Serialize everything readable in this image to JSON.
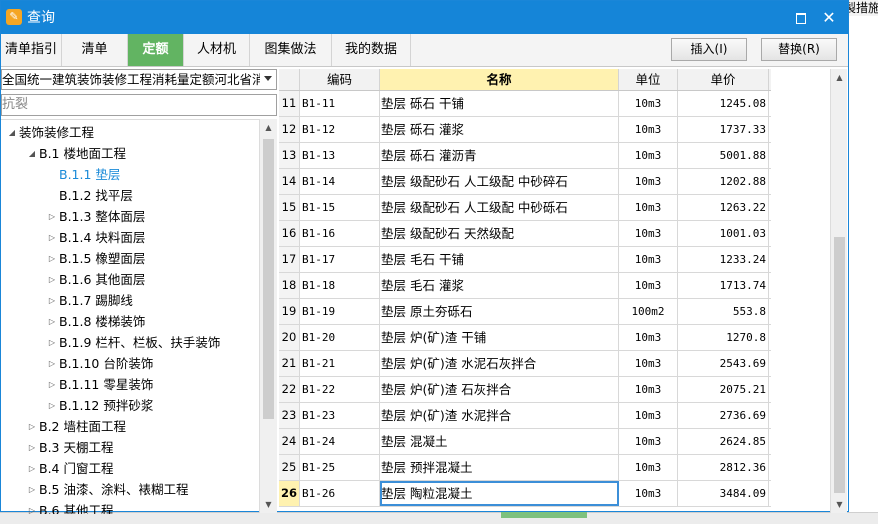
{
  "background_fragment": "製措施",
  "dialog": {
    "title": "查询",
    "restore_icon": "restore-icon",
    "close_glyph": "✕"
  },
  "tabs": [
    {
      "label": "清单指引",
      "active": false
    },
    {
      "label": "清单",
      "active": false
    },
    {
      "label": "定额",
      "active": true
    },
    {
      "label": "人材机",
      "active": false
    },
    {
      "label": "图集做法",
      "active": false
    },
    {
      "label": "我的数据",
      "active": false
    }
  ],
  "buttons": {
    "insert": "插入(I)",
    "replace": "替换(R)"
  },
  "library_select": {
    "value": "全国统一建筑装饰装修工程消耗量定额河北省消耗"
  },
  "search": {
    "value": "抗裂"
  },
  "tree": [
    {
      "label": "装饰装修工程",
      "level": 0,
      "arrow": "expanded"
    },
    {
      "label": "B.1 楼地面工程",
      "level": 1,
      "arrow": "expanded"
    },
    {
      "label": "B.1.1 垫层",
      "level": 2,
      "arrow": "none",
      "selected": true
    },
    {
      "label": "B.1.2 找平层",
      "level": 2,
      "arrow": "none"
    },
    {
      "label": "B.1.3 整体面层",
      "level": 2,
      "arrow": "collapsed"
    },
    {
      "label": "B.1.4 块料面层",
      "level": 2,
      "arrow": "collapsed"
    },
    {
      "label": "B.1.5 橡塑面层",
      "level": 2,
      "arrow": "collapsed"
    },
    {
      "label": "B.1.6 其他面层",
      "level": 2,
      "arrow": "collapsed"
    },
    {
      "label": "B.1.7 踢脚线",
      "level": 2,
      "arrow": "collapsed"
    },
    {
      "label": "B.1.8 楼梯装饰",
      "level": 2,
      "arrow": "collapsed"
    },
    {
      "label": "B.1.9 栏杆、栏板、扶手装饰",
      "level": 2,
      "arrow": "collapsed"
    },
    {
      "label": "B.1.10 台阶装饰",
      "level": 2,
      "arrow": "collapsed"
    },
    {
      "label": "B.1.11 零星装饰",
      "level": 2,
      "arrow": "collapsed"
    },
    {
      "label": "B.1.12 预拌砂浆",
      "level": 2,
      "arrow": "collapsed"
    },
    {
      "label": "B.2 墙柱面工程",
      "level": 1,
      "arrow": "collapsed"
    },
    {
      "label": "B.3 天棚工程",
      "level": 1,
      "arrow": "collapsed"
    },
    {
      "label": "B.4 门窗工程",
      "level": 1,
      "arrow": "collapsed"
    },
    {
      "label": "B.5 油漆、涂料、裱糊工程",
      "level": 1,
      "arrow": "collapsed"
    },
    {
      "label": "B.6 其他工程",
      "level": 1,
      "arrow": "collapsed"
    }
  ],
  "table": {
    "columns": {
      "code": "编码",
      "name": "名称",
      "unit": "单位",
      "price": "单价"
    },
    "rows": [
      {
        "idx": "11",
        "code": "B1-11",
        "name": "垫层 砾石 干铺",
        "unit": "10m3",
        "price": "1245.08"
      },
      {
        "idx": "12",
        "code": "B1-12",
        "name": "垫层 砾石 灌浆",
        "unit": "10m3",
        "price": "1737.33"
      },
      {
        "idx": "13",
        "code": "B1-13",
        "name": "垫层 砾石 灌沥青",
        "unit": "10m3",
        "price": "5001.88"
      },
      {
        "idx": "14",
        "code": "B1-14",
        "name": "垫层 级配砂石 人工级配 中砂碎石",
        "unit": "10m3",
        "price": "1202.88"
      },
      {
        "idx": "15",
        "code": "B1-15",
        "name": "垫层 级配砂石 人工级配 中砂砾石",
        "unit": "10m3",
        "price": "1263.22"
      },
      {
        "idx": "16",
        "code": "B1-16",
        "name": "垫层 级配砂石 天然级配",
        "unit": "10m3",
        "price": "1001.03"
      },
      {
        "idx": "17",
        "code": "B1-17",
        "name": "垫层 毛石 干铺",
        "unit": "10m3",
        "price": "1233.24"
      },
      {
        "idx": "18",
        "code": "B1-18",
        "name": "垫层 毛石 灌浆",
        "unit": "10m3",
        "price": "1713.74"
      },
      {
        "idx": "19",
        "code": "B1-19",
        "name": "垫层 原土夯砾石",
        "unit": "100m2",
        "price": "553.8"
      },
      {
        "idx": "20",
        "code": "B1-20",
        "name": "垫层 炉(矿)渣 干铺",
        "unit": "10m3",
        "price": "1270.8"
      },
      {
        "idx": "21",
        "code": "B1-21",
        "name": "垫层 炉(矿)渣 水泥石灰拌合",
        "unit": "10m3",
        "price": "2543.69"
      },
      {
        "idx": "22",
        "code": "B1-22",
        "name": "垫层 炉(矿)渣 石灰拌合",
        "unit": "10m3",
        "price": "2075.21"
      },
      {
        "idx": "23",
        "code": "B1-23",
        "name": "垫层 炉(矿)渣 水泥拌合",
        "unit": "10m3",
        "price": "2736.69"
      },
      {
        "idx": "24",
        "code": "B1-24",
        "name": "垫层 混凝土",
        "unit": "10m3",
        "price": "2624.85"
      },
      {
        "idx": "25",
        "code": "B1-25",
        "name": "垫层 预拌混凝土",
        "unit": "10m3",
        "price": "2812.36"
      },
      {
        "idx": "26",
        "code": "B1-26",
        "name": "垫层 陶粒混凝土",
        "unit": "10m3",
        "price": "3484.09",
        "current": true
      }
    ]
  },
  "colors": {
    "titlebar": "#1585d8",
    "active_tab": "#62b462",
    "header_highlight": "#fff2b0",
    "tree_selected": "#1a8ad8"
  }
}
